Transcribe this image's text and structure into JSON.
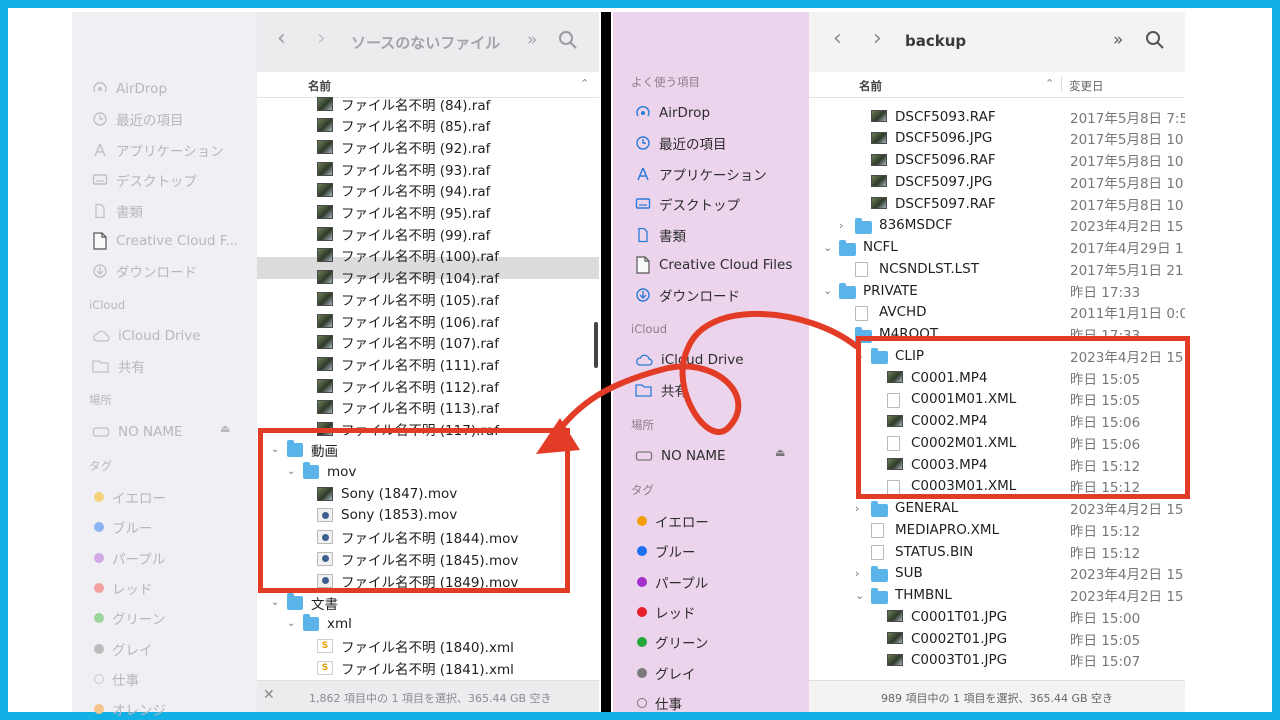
{
  "left": {
    "title": "ソースのないファイル",
    "column_header": "名前",
    "sidebar": {
      "items_top": [
        {
          "label": "AirDrop",
          "icon": "airdrop-icon"
        },
        {
          "label": "最近の項目",
          "icon": "clock-icon"
        },
        {
          "label": "アプリケーション",
          "icon": "apps-icon"
        },
        {
          "label": "デスクトップ",
          "icon": "desktop-icon"
        },
        {
          "label": "書類",
          "icon": "document-icon"
        },
        {
          "label": "Creative Cloud F...",
          "icon": "file-icon"
        },
        {
          "label": "ダウンロード",
          "icon": "download-icon"
        }
      ],
      "icloud_header": "iCloud",
      "icloud_items": [
        {
          "label": "iCloud Drive",
          "icon": "cloud-icon"
        },
        {
          "label": "共有",
          "icon": "shared-folder-icon"
        }
      ],
      "places_header": "場所",
      "places_items": [
        {
          "label": "NO NAME",
          "icon": "drive-icon"
        }
      ],
      "tags_header": "タグ",
      "tags": [
        {
          "label": "イエロー",
          "color": "#f3d27a"
        },
        {
          "label": "ブルー",
          "color": "#8ab4f2"
        },
        {
          "label": "パープル",
          "color": "#d2a8e6"
        },
        {
          "label": "レッド",
          "color": "#f2a0a0"
        },
        {
          "label": "グリーン",
          "color": "#9cd49c"
        },
        {
          "label": "グレイ",
          "color": "#bcbcbc"
        },
        {
          "label": "仕事",
          "color": "outline"
        },
        {
          "label": "オレンジ",
          "color": "#f5c48a"
        }
      ]
    },
    "files": [
      "ファイル名不明 (84).raf",
      "ファイル名不明 (85).raf",
      "ファイル名不明 (92).raf",
      "ファイル名不明 (93).raf",
      "ファイル名不明 (94).raf",
      "ファイル名不明 (95).raf",
      "ファイル名不明 (99).raf",
      "ファイル名不明 (100).raf",
      "ファイル名不明 (104).raf",
      "ファイル名不明 (105).raf",
      "ファイル名不明 (106).raf",
      "ファイル名不明 (107).raf",
      "ファイル名不明 (111).raf",
      "ファイル名不明 (112).raf",
      "ファイル名不明 (113).raf",
      "ファイル名不明 (117).raf"
    ],
    "video_folder": "動画",
    "mov_folder": "mov",
    "mov_files": [
      "Sony (1847).mov",
      "Sony (1853).mov",
      "ファイル名不明 (1844).mov",
      "ファイル名不明 (1845).mov",
      "ファイル名不明 (1849).mov"
    ],
    "doc_folder": "文書",
    "xml_folder": "xml",
    "xml_files": [
      "ファイル名不明 (1840).xml",
      "ファイル名不明 (1841).xml"
    ],
    "status": "1,862 項目中の 1 項目を選択、365.44 GB 空き"
  },
  "right": {
    "title": "backup",
    "col_name": "名前",
    "col_date": "変更日",
    "sidebar": {
      "favorites_header": "よく使う項目",
      "items_top": [
        {
          "label": "AirDrop",
          "icon": "airdrop-icon"
        },
        {
          "label": "最近の項目",
          "icon": "clock-icon"
        },
        {
          "label": "アプリケーション",
          "icon": "apps-icon"
        },
        {
          "label": "デスクトップ",
          "icon": "desktop-icon"
        },
        {
          "label": "書類",
          "icon": "document-icon"
        },
        {
          "label": "Creative Cloud Files",
          "icon": "file-icon"
        },
        {
          "label": "ダウンロード",
          "icon": "download-icon"
        }
      ],
      "icloud_header": "iCloud",
      "icloud_items": [
        {
          "label": "iCloud Drive",
          "icon": "cloud-icon"
        },
        {
          "label": "共有",
          "icon": "shared-folder-icon"
        }
      ],
      "places_header": "場所",
      "places_items": [
        {
          "label": "NO NAME",
          "icon": "drive-icon"
        }
      ],
      "tags_header": "タグ",
      "tags": [
        {
          "label": "イエロー",
          "color": "#f59e0b"
        },
        {
          "label": "ブルー",
          "color": "#1e6ff0"
        },
        {
          "label": "パープル",
          "color": "#a42fc9"
        },
        {
          "label": "レッド",
          "color": "#e8202a"
        },
        {
          "label": "グリーン",
          "color": "#22a83a"
        },
        {
          "label": "グレイ",
          "color": "#7a7a7a"
        },
        {
          "label": "仕事",
          "color": "outline"
        }
      ]
    },
    "rows": [
      {
        "name": "DSCF5093.RAF",
        "date": "2017年5月8日 7:5",
        "kind": "thumb",
        "level": 2
      },
      {
        "name": "DSCF5096.JPG",
        "date": "2017年5月8日 10:",
        "kind": "thumb",
        "level": 2
      },
      {
        "name": "DSCF5096.RAF",
        "date": "2017年5月8日 10:",
        "kind": "thumb",
        "level": 2
      },
      {
        "name": "DSCF5097.JPG",
        "date": "2017年5月8日 10:",
        "kind": "thumb",
        "level": 2
      },
      {
        "name": "DSCF5097.RAF",
        "date": "2017年5月8日 10:",
        "kind": "thumb",
        "level": 2
      },
      {
        "name": "836MSDCF",
        "date": "2023年4月2日 15",
        "kind": "folder-closed",
        "level": 1
      },
      {
        "name": "NCFL",
        "date": "2017年4月29日 1:",
        "kind": "folder-open",
        "level": 0
      },
      {
        "name": "NCSNDLST.LST",
        "date": "2017年5月1日 21:",
        "kind": "doc",
        "level": 1
      },
      {
        "name": "PRIVATE",
        "date": "昨日 17:33",
        "kind": "folder-open",
        "level": 0
      },
      {
        "name": "AVCHD",
        "date": "2011年1月1日 0:0",
        "kind": "doc",
        "level": 1
      },
      {
        "name": "M4ROOT",
        "date": "昨日 17:33",
        "kind": "folder-open",
        "level": 1
      },
      {
        "name": "CLIP",
        "date": "2023年4月2日 15",
        "kind": "folder-open",
        "level": 2
      },
      {
        "name": "C0001.MP4",
        "date": "昨日 15:05",
        "kind": "thumb",
        "level": 3
      },
      {
        "name": "C0001M01.XML",
        "date": "昨日 15:05",
        "kind": "doc",
        "level": 3
      },
      {
        "name": "C0002.MP4",
        "date": "昨日 15:06",
        "kind": "thumb",
        "level": 3
      },
      {
        "name": "C0002M01.XML",
        "date": "昨日 15:06",
        "kind": "doc",
        "level": 3
      },
      {
        "name": "C0003.MP4",
        "date": "昨日 15:12",
        "kind": "thumb",
        "level": 3
      },
      {
        "name": "C0003M01.XML",
        "date": "昨日 15:12",
        "kind": "doc",
        "level": 3
      },
      {
        "name": "GENERAL",
        "date": "2023年4月2日 15",
        "kind": "folder-closed",
        "level": 2
      },
      {
        "name": "MEDIAPRO.XML",
        "date": "昨日 15:12",
        "kind": "doc",
        "level": 2
      },
      {
        "name": "STATUS.BIN",
        "date": "昨日 15:12",
        "kind": "doc",
        "level": 2
      },
      {
        "name": "SUB",
        "date": "2023年4月2日 15",
        "kind": "folder-closed",
        "level": 2
      },
      {
        "name": "THMBNL",
        "date": "2023年4月2日 15",
        "kind": "folder-open",
        "level": 2
      },
      {
        "name": "C0001T01.JPG",
        "date": "昨日 15:00",
        "kind": "thumb",
        "level": 3
      },
      {
        "name": "C0002T01.JPG",
        "date": "昨日 15:05",
        "kind": "thumb",
        "level": 3
      },
      {
        "name": "C0003T01.JPG",
        "date": "昨日 15:07",
        "kind": "thumb",
        "level": 3
      }
    ],
    "status": "989 項目中の 1 項目を選択、365.44 GB 空き"
  },
  "colors": {
    "border": "#12b0e4",
    "highlight_box": "#e23b26",
    "right_sidebar": "#ecd5ec",
    "left_sidebar": "#f0eff3",
    "folder": "#5ab4ea"
  }
}
